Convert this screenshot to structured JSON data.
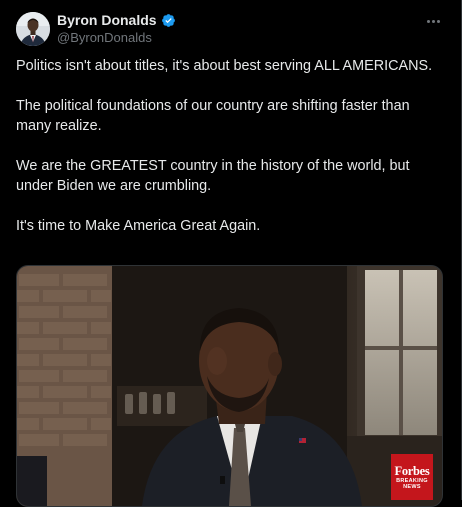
{
  "author": {
    "display_name": "Byron Donalds",
    "handle": "@ByronDonalds",
    "verified": true,
    "verified_color": "#1d9bf0"
  },
  "tweet": {
    "paragraphs": [
      "Politics isn't about titles, it's about best serving ALL AMERICANS.",
      "The political foundations of our country are shifting faster than many realize.",
      "We are the GREATEST country in the history of the world, but under Biden we are crumbling.",
      "It's time to Make America Great Again."
    ]
  },
  "media": {
    "watermark": {
      "brand": "Forbes",
      "line1": "BREAKING",
      "line2": "NEWS",
      "color": "#c4161c"
    }
  },
  "icons": {
    "more": "more-horizontal-icon",
    "verified": "verified-badge-icon"
  },
  "colors": {
    "background": "#000000",
    "text": "#e7e9ea",
    "secondary_text": "#71767b",
    "border": "#2f3336"
  }
}
